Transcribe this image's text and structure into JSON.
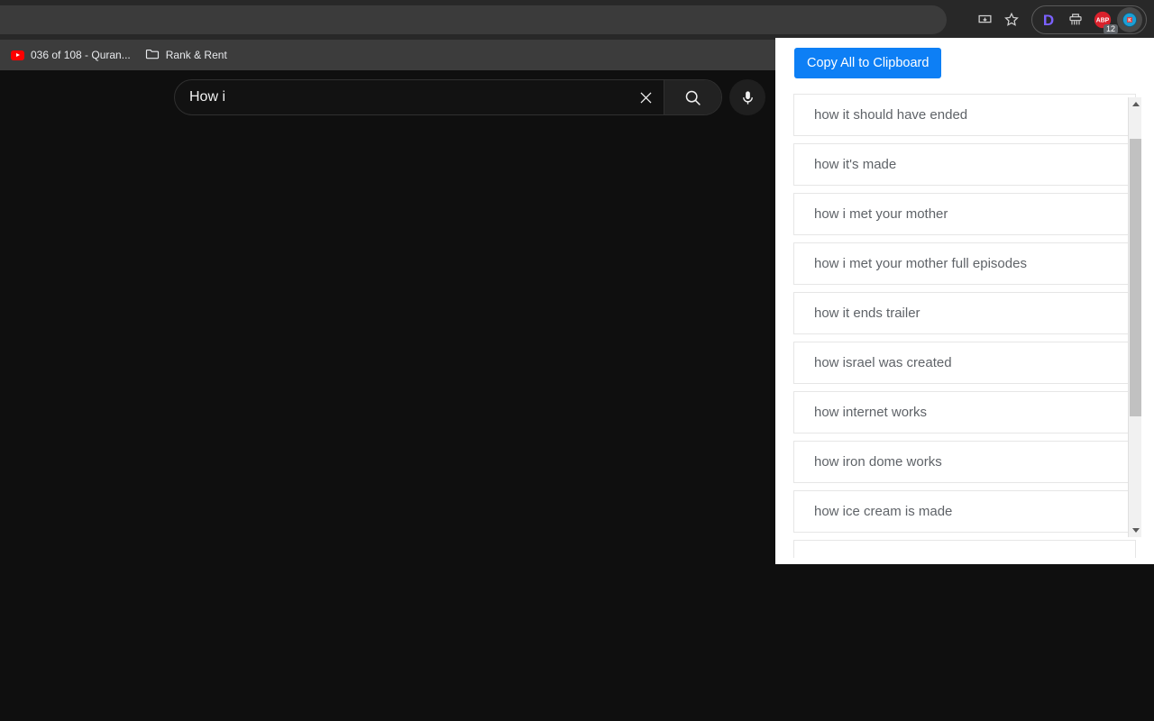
{
  "browser": {
    "toolbar": {
      "icons": [
        {
          "name": "install-app-icon",
          "glyph": "install"
        },
        {
          "name": "bookmark-star-icon",
          "glyph": "star"
        }
      ],
      "extensions": [
        {
          "name": "extension-d-icon",
          "label": "D",
          "badge": ""
        },
        {
          "name": "extension-shredder-icon",
          "label": "",
          "badge": ""
        },
        {
          "name": "extension-adblock-icon",
          "label": "ABP",
          "badge": "12"
        },
        {
          "name": "extension-keyword-tool-icon",
          "label": "",
          "badge": ""
        }
      ]
    },
    "bookmarks": [
      {
        "icon": "youtube-favicon",
        "label": "036 of 108 - Quran..."
      },
      {
        "icon": "folder-icon",
        "label": "Rank & Rent"
      }
    ]
  },
  "youtube": {
    "search": {
      "value": "How i",
      "placeholder": "Search",
      "clear_title": "Clear search query",
      "search_title": "Search",
      "mic_title": "Search with your voice"
    }
  },
  "panel": {
    "copy_button": "Copy All to Clipboard",
    "accent_color": "#0d7ff5",
    "keywords": [
      "how it should have ended",
      "how it's made",
      "how i met your mother",
      "how i met your mother full episodes",
      "how it ends trailer",
      "how israel was created",
      "how internet works",
      "how iron dome works",
      "how ice cream is made",
      ""
    ],
    "scrollbar": {
      "up_arrow": "▲",
      "down_arrow": "▼"
    }
  }
}
